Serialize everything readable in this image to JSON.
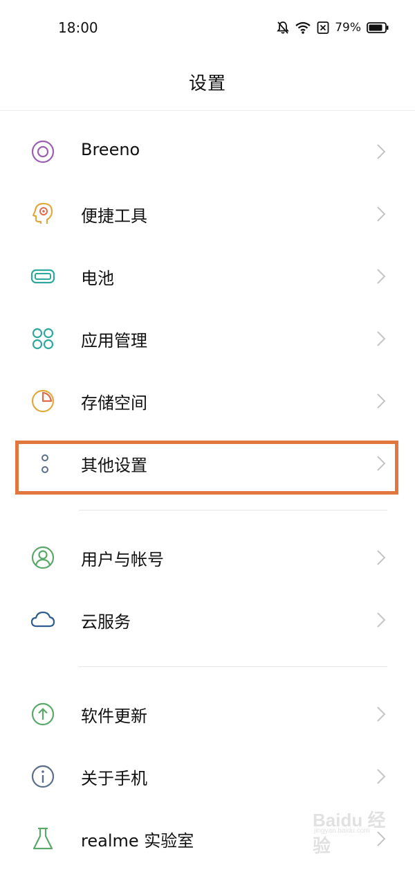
{
  "status": {
    "time": "18:00",
    "battery_percent": "79%"
  },
  "title": "设置",
  "sections": [
    {
      "items": [
        {
          "label": "Breeno",
          "icon": "breeno-icon",
          "color": "#9b5fb4"
        },
        {
          "label": "便捷工具",
          "icon": "quick-tools-icon",
          "color": "#e0a93e"
        },
        {
          "label": "电池",
          "icon": "battery-icon",
          "color": "#2ea89a"
        },
        {
          "label": "应用管理",
          "icon": "app-management-icon",
          "color": "#2ea89a"
        },
        {
          "label": "存储空间",
          "icon": "storage-icon",
          "color": "#e0a93e"
        },
        {
          "label": "其他设置",
          "icon": "other-settings-icon",
          "color": "#5a6e8c"
        }
      ]
    },
    {
      "items": [
        {
          "label": "用户与帐号",
          "icon": "user-account-icon",
          "color": "#5aa86a"
        },
        {
          "label": "云服务",
          "icon": "cloud-icon",
          "color": "#2f5c8c"
        }
      ]
    },
    {
      "items": [
        {
          "label": "软件更新",
          "icon": "software-update-icon",
          "color": "#5aa86a"
        },
        {
          "label": "关于手机",
          "icon": "about-phone-icon",
          "color": "#5a6e8c"
        },
        {
          "label": "realme 实验室",
          "icon": "flask-icon",
          "color": "#5aa86a"
        }
      ]
    }
  ],
  "highlight_color": "#e2763f",
  "watermark": {
    "text": "Baidu 经验",
    "sub": "jingyan.baidu.com"
  }
}
